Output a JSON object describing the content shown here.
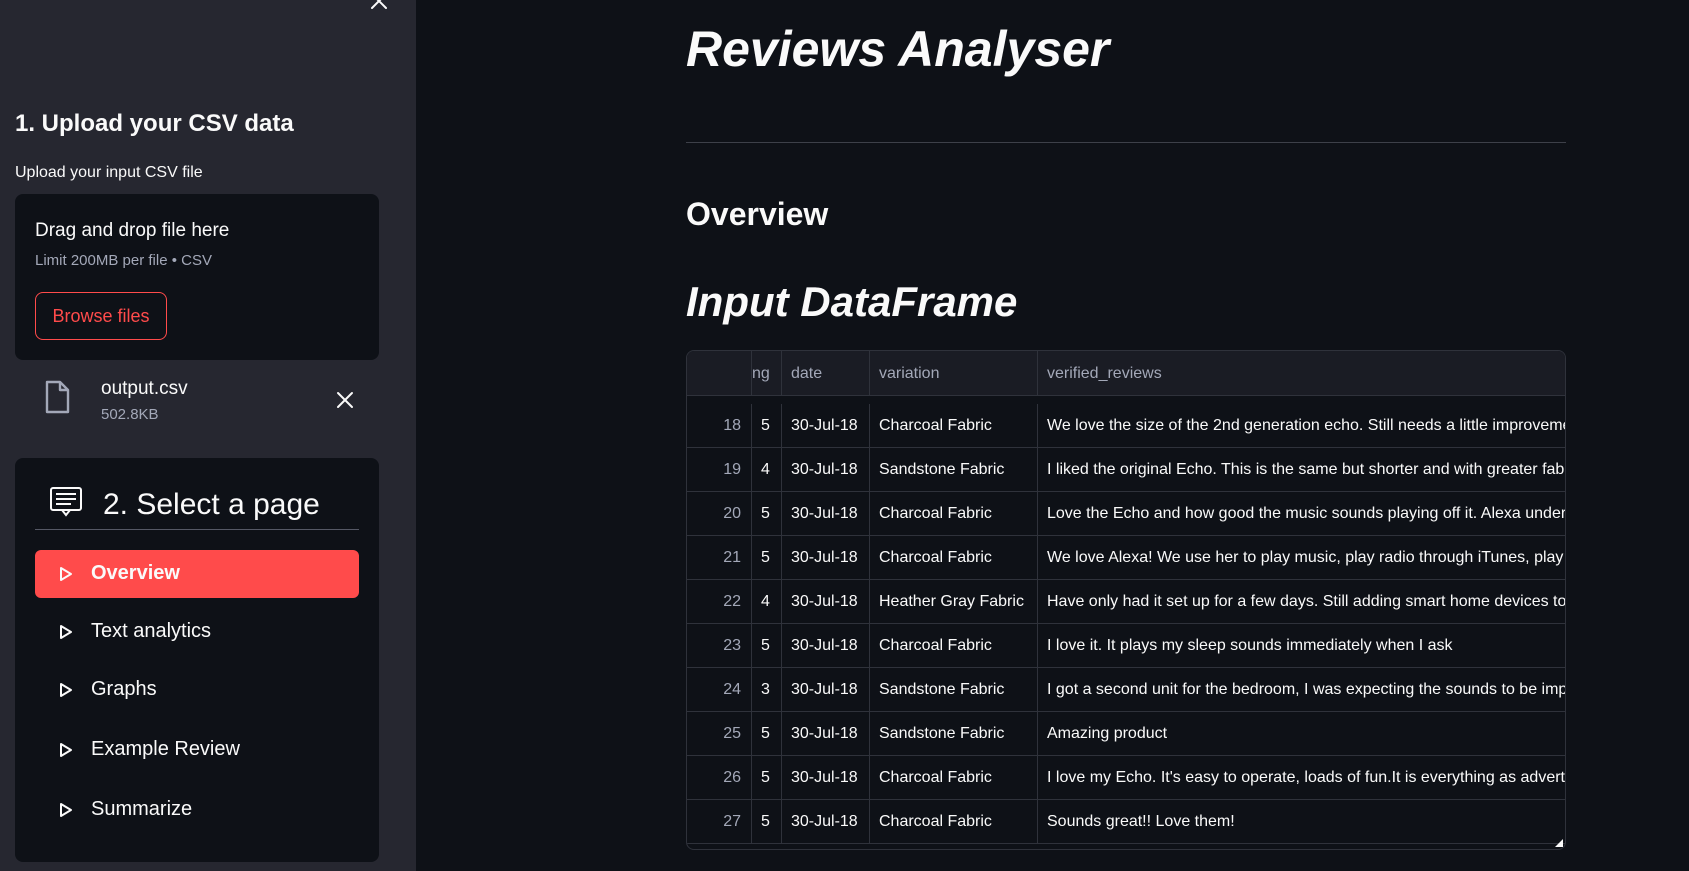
{
  "sidebar": {
    "upload_heading": "1. Upload your CSV data",
    "upload_label": "Upload your input CSV file",
    "dropzone": {
      "title": "Drag and drop file here",
      "limit": "Limit 200MB per file • CSV",
      "browse_label": "Browse files"
    },
    "file": {
      "name": "output.csv",
      "size": "502.8KB"
    },
    "menu": {
      "title": "2. Select a page",
      "items": [
        {
          "label": "Overview",
          "active": true
        },
        {
          "label": "Text analytics",
          "active": false
        },
        {
          "label": "Graphs",
          "active": false
        },
        {
          "label": "Example Review",
          "active": false
        },
        {
          "label": "Summarize",
          "active": false
        }
      ]
    }
  },
  "main": {
    "title": "Reviews Analyser",
    "section_heading": "Overview",
    "dataframe_heading": "Input DataFrame",
    "table": {
      "columns": [
        "",
        "ng",
        "date",
        "variation",
        "verified_reviews"
      ],
      "rows": [
        [
          "18",
          "5",
          "30-Jul-18",
          "Charcoal Fabric",
          "We love the size of the 2nd generation echo. Still needs a little improvements"
        ],
        [
          "19",
          "4",
          "30-Jul-18",
          "Sandstone Fabric",
          "I liked the original Echo. This is the same but shorter and with greater fabric"
        ],
        [
          "20",
          "5",
          "30-Jul-18",
          "Charcoal Fabric",
          "Love the Echo and how good the music sounds playing off it. Alexa understands"
        ],
        [
          "21",
          "5",
          "30-Jul-18",
          "Charcoal Fabric",
          "We love Alexa! We use her to play music, play radio through iTunes, play"
        ],
        [
          "22",
          "4",
          "30-Jul-18",
          "Heather Gray Fabric",
          "Have only had it set up for a few days. Still adding smart home devices to"
        ],
        [
          "23",
          "5",
          "30-Jul-18",
          "Charcoal Fabric",
          "I love it. It plays my sleep sounds immediately when I ask"
        ],
        [
          "24",
          "3",
          "30-Jul-18",
          "Sandstone Fabric",
          "I got a second unit for the bedroom, I was expecting the sounds to be improved"
        ],
        [
          "25",
          "5",
          "30-Jul-18",
          "Sandstone Fabric",
          "Amazing product"
        ],
        [
          "26",
          "5",
          "30-Jul-18",
          "Charcoal Fabric",
          "I love my Echo. It's easy to operate, loads of fun.It is everything as advertised"
        ],
        [
          "27",
          "5",
          "30-Jul-18",
          "Charcoal Fabric",
          "Sounds great!! Love them!"
        ]
      ]
    }
  },
  "colors": {
    "accent": "#ff4b4b",
    "sidebar_bg": "#262730",
    "app_bg": "#0e1117"
  }
}
